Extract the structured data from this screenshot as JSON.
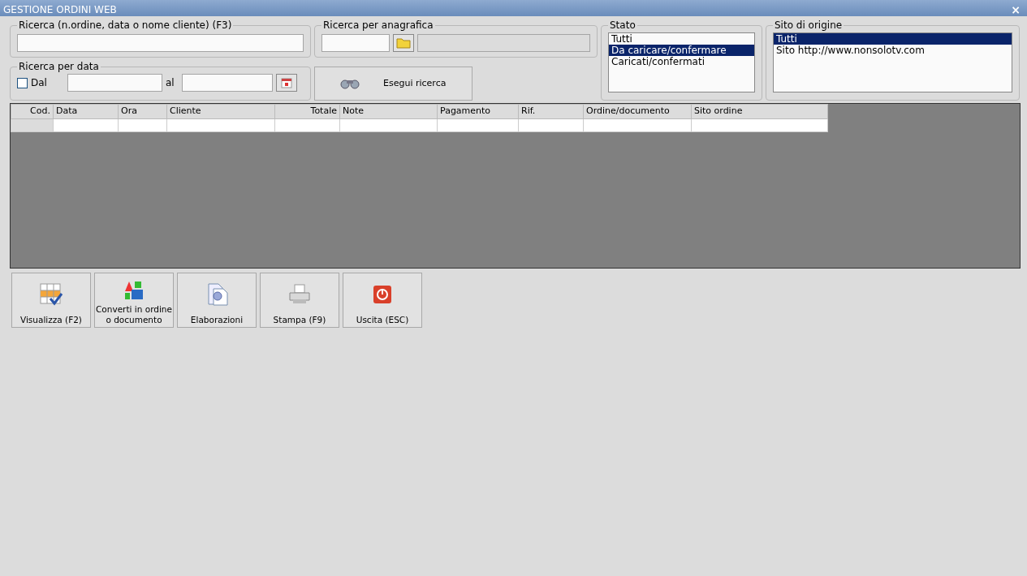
{
  "window": {
    "title": "GESTIONE ORDINI WEB",
    "close": "×"
  },
  "search": {
    "label": "Ricerca (n.ordine, data o nome cliente) (F3)"
  },
  "registry_search": {
    "label": "Ricerca per anagrafica"
  },
  "date_search": {
    "label": "Ricerca per data",
    "from_label": "Dal",
    "from_checked": false,
    "to_label": "al"
  },
  "run_search_button": "Esegui ricerca",
  "status": {
    "label": "Stato",
    "items": [
      {
        "label": "Tutti",
        "selected": false
      },
      {
        "label": "Da caricare/confermare",
        "selected": true
      },
      {
        "label": "Caricati/confermati",
        "selected": false
      }
    ]
  },
  "origin_site": {
    "label": "Sito di origine",
    "items": [
      {
        "label": "Tutti",
        "selected": true
      },
      {
        "label": "Sito http://www.nonsolotv.com",
        "selected": false
      }
    ]
  },
  "table": {
    "columns": [
      {
        "label": "Cod.",
        "kind": "number"
      },
      {
        "label": "Data",
        "kind": "text"
      },
      {
        "label": "Ora",
        "kind": "text"
      },
      {
        "label": "Cliente",
        "kind": "text"
      },
      {
        "label": "Totale",
        "kind": "number"
      },
      {
        "label": "Note",
        "kind": "text"
      },
      {
        "label": "Pagamento",
        "kind": "text"
      },
      {
        "label": "Rif.",
        "kind": "text"
      },
      {
        "label": "Ordine/documento",
        "kind": "text"
      },
      {
        "label": "Sito ordine",
        "kind": "text"
      }
    ]
  },
  "buttons": [
    {
      "label": "Visualizza (F2)",
      "kind": "grid"
    },
    {
      "label": "Converti in ordine\no documento",
      "kind": "convert"
    },
    {
      "label": "Elaborazioni",
      "kind": "process"
    },
    {
      "label": "Stampa (F9)",
      "kind": "print"
    },
    {
      "label": "Uscita (ESC)",
      "kind": "exit"
    }
  ]
}
